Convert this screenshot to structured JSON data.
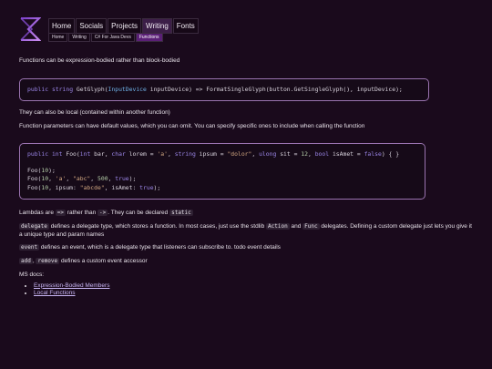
{
  "nav": {
    "items": [
      {
        "label": "Home"
      },
      {
        "label": "Socials"
      },
      {
        "label": "Projects"
      },
      {
        "label": "Writing"
      },
      {
        "label": "Fonts"
      }
    ],
    "active_index": 3
  },
  "breadcrumb": {
    "items": [
      {
        "label": "Home"
      },
      {
        "label": "Writing"
      },
      {
        "label": "C# For Java Devs"
      },
      {
        "label": "Functions"
      }
    ]
  },
  "main": {
    "p1": "Functions can be expression-bodied rather than block-bodied",
    "code1": {
      "kw1": "public",
      "kw2": "string",
      "fname": "GetGlyph",
      "paren_open": "(",
      "ptype": "InputDevice",
      "pname": "inputDevice",
      "rest": ") => FormatSingleGlyph(button.GetSingleGlyph(), inputDevice);"
    },
    "p2": "They can also be local (contained within another function)",
    "p3": "Function parameters can have default values, which you can omit. You can specify specific ones to include when calling the function",
    "code2": {
      "l1": {
        "kw1": "public",
        "kw2": "int",
        "fname": "Foo",
        "open": "(",
        "t1": "int",
        "n1": "bar, ",
        "t2": "char",
        "n2": "lorem = ",
        "v2": "'a'",
        "c2": ", ",
        "t3": "string",
        "n3": "ipsum = ",
        "v3": "\"dolor\"",
        "c3": ", ",
        "t4": "ulong",
        "n4": "sit = ",
        "v4": "12",
        "c4": ", ",
        "t5": "bool",
        "n5": "isAmet = ",
        "v5": "false",
        "tail": ") { }"
      },
      "l2": {
        "pre": "Foo(",
        "a": "10",
        "post": ");"
      },
      "l3": {
        "pre": "Foo(",
        "a": "10",
        "b": ", ",
        "c": "'a'",
        "d": ", ",
        "e": "\"abc\"",
        "f": ", ",
        "g": "500",
        "h": ", ",
        "i": "true",
        "j": ");"
      },
      "l4": {
        "pre": "Foo(",
        "a": "10",
        "b": ", ipsum: ",
        "c": "\"abcde\"",
        "d": ", isAmet: ",
        "e": "true",
        "f": ");"
      }
    },
    "p4": {
      "a": "Lambdas are ",
      "b": "=>",
      "c": " rather than ",
      "d": "->",
      "e": ". They can be declared ",
      "f": "static"
    },
    "p5": {
      "a": "delegate",
      "b": " defines a delegate type, which stores a function. In most cases, just use the stdlib ",
      "c": "Action",
      "d": " and ",
      "e": "Func",
      "f": " delegates. Defining a custom delegate just lets you give it a unique type and param names"
    },
    "p6": {
      "a": "event",
      "b": " defines an event, which is a delegate type that listeners can subscribe to. todo event details"
    },
    "p7": {
      "a": "add",
      "b": ", ",
      "c": "remove",
      "d": " defines a custom event accessor"
    },
    "p8": "MS docs:",
    "links": [
      {
        "label": "Expression-Bodied Members"
      },
      {
        "label": "Local Functions"
      }
    ]
  },
  "colors": {
    "background": "#1a0a1c",
    "accent": "#9b6bd0",
    "active_nav": "#3c1e48",
    "active_crumb": "#5a1f76"
  }
}
